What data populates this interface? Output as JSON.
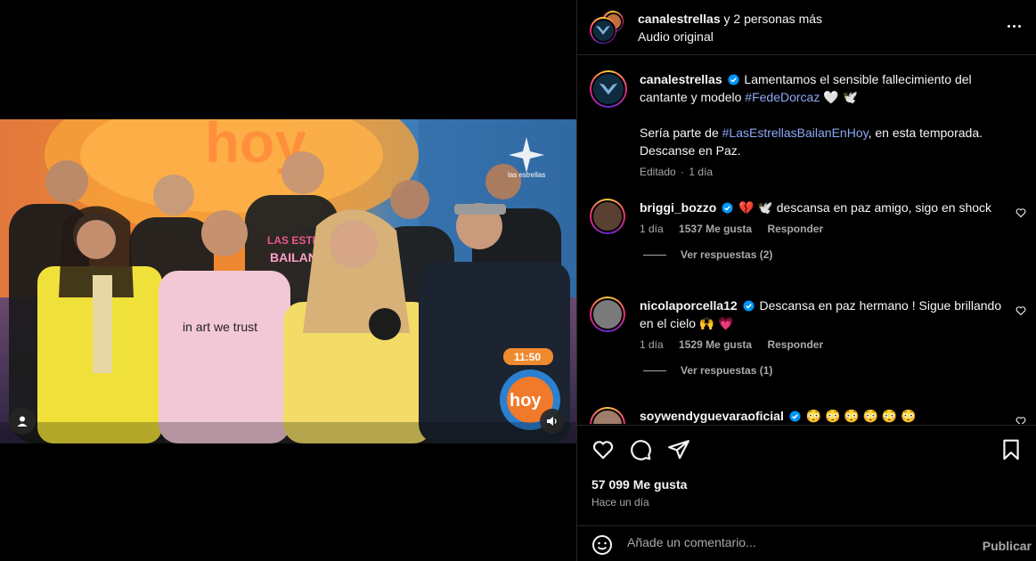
{
  "header": {
    "account": "canalestrellas",
    "others": "y 2 personas más",
    "audio": "Audio original",
    "more_icon": "more-horizontal-icon"
  },
  "video": {
    "clock": "11:50",
    "watermark": "las estrellas",
    "shirt_text": "in art we trust",
    "user_tag_icon": "user-icon",
    "mute_icon": "speaker-icon"
  },
  "caption": {
    "username": "canalestrellas",
    "text_1": "Lamentamos el sensible fallecimiento del cantante y modelo",
    "hashtag_1": "#FedeDorcaz",
    "emojis_1": "🤍 🕊️",
    "text_2": "Sería parte de",
    "hashtag_2": "#LasEstrellasBailanEnHoy",
    "text_3": ", en esta temporada. Descanse en Paz.",
    "edited": "Editado",
    "sep": "·",
    "time": "1 día"
  },
  "comments": [
    {
      "username": "briggi_bozzo",
      "text": "💔 🕊️ descansa en paz amigo, sigo en shock",
      "time": "1 día",
      "likes": "1537 Me gusta",
      "reply": "Responder",
      "view_replies": "Ver respuestas (2)"
    },
    {
      "username": "nicolaporcella12",
      "text": "Descansa en paz hermano ! Sigue brillando en el cielo 🙌 💗",
      "time": "1 día",
      "likes": "1529 Me gusta",
      "reply": "Responder",
      "view_replies": "Ver respuestas (1)"
    },
    {
      "username": "soywendyguevaraoficial",
      "text": "😳 😳 😳 😳 😳 😳"
    }
  ],
  "actions": {
    "like_icon": "heart-icon",
    "comment_icon": "comment-icon",
    "share_icon": "paper-plane-icon",
    "save_icon": "bookmark-icon",
    "likes": "57 099 Me gusta",
    "posted": "Hace un día"
  },
  "compose": {
    "emoji_icon": "emoji-icon",
    "placeholder": "Añade un comentario...",
    "publish": "Publicar"
  },
  "colors": {
    "background": "#000000",
    "divider": "#262626",
    "secondary_text": "#a8a8a8",
    "hashtag": "#8fa8f8",
    "verified": "#0095f6"
  }
}
